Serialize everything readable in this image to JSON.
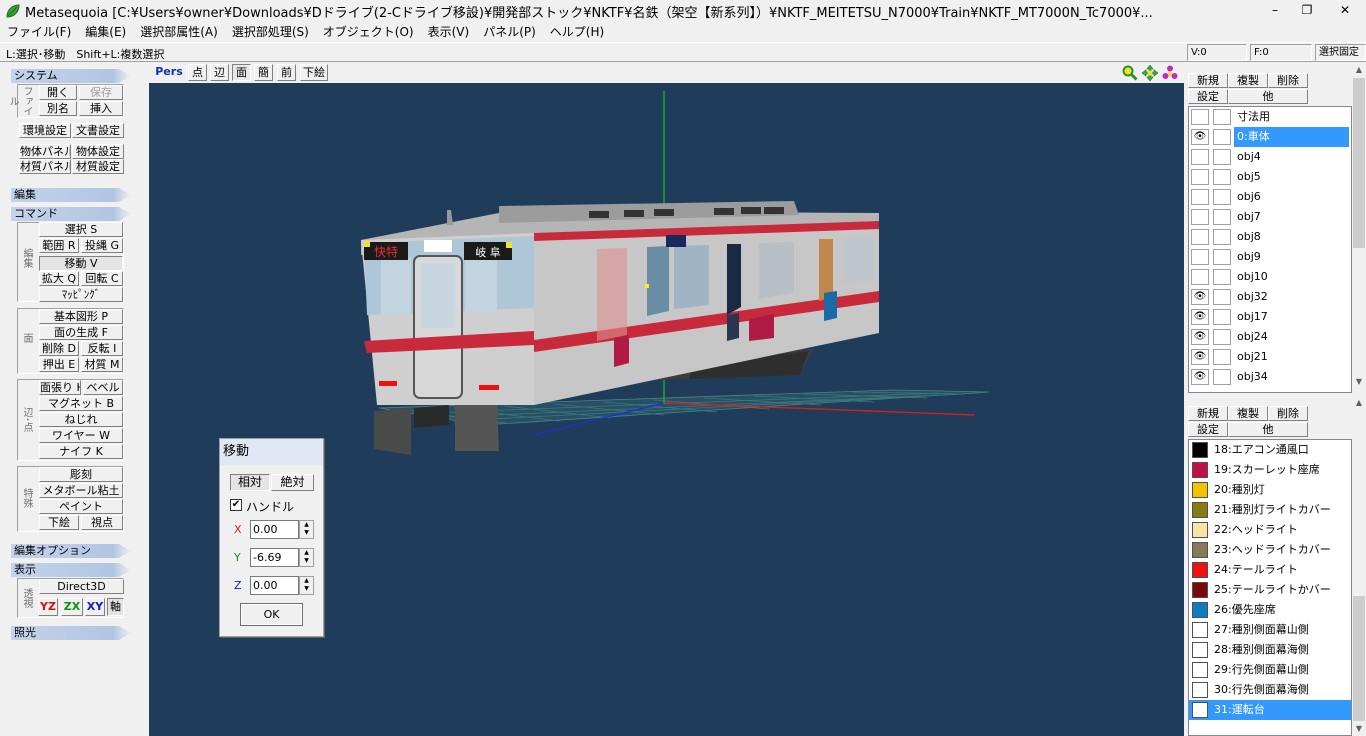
{
  "window": {
    "title": "Metasequoia [C:¥Users¥owner¥Downloads¥Dドライブ(2-Cドライブ移設)¥開発部ストック¥NKTF¥名鉄（架空【新系列】）¥NKTF_MEITETSU_N7000¥Train¥NKTF_MT7000N_Tc7000¥...",
    "minimize": "–",
    "restore": "❐",
    "close": "✕"
  },
  "menu": [
    "ファイル(F)",
    "編集(E)",
    "選択部属性(A)",
    "選択部処理(S)",
    "オブジェクト(O)",
    "表示(V)",
    "パネル(P)",
    "ヘルプ(H)"
  ],
  "status": {
    "hint": "L:選択･移動　Shift+L:複数選択",
    "v": "V:0",
    "f": "F:0",
    "lock": "選択固定"
  },
  "left": {
    "system": "システム",
    "file_label": "ファイル",
    "open": "開く",
    "save": "保存",
    "save_as": "別名",
    "insert": "挿入",
    "env": "環境設定",
    "doc": "文書設定",
    "objpanel": "物体パネル",
    "objsetting": "物体設定",
    "matpanel": "材質パネル",
    "matsetting": "材質設定",
    "edit": "編集",
    "command": "コマンド",
    "edit_label": "編集",
    "select": "選択 S",
    "range": "範囲 R",
    "lasso": "投縄 G",
    "move": "移動 V",
    "scale": "拡大 Q",
    "rotate": "回転 C",
    "mapping": "ﾏｯﾋﾟﾝｸﾞ",
    "face_label": "面",
    "basic": "基本図形 P",
    "face_gen": "面の生成 F",
    "delete": "削除 D",
    "invert": "反転 I",
    "extrude": "押出 E",
    "material": "材質 M",
    "edgevert_label": "辺･点",
    "face_paste": "面張り H",
    "bevel": "ベベル",
    "magnet": "マグネット B",
    "twist": "ねじれ",
    "wire": "ワイヤー W",
    "knife": "ナイフ K",
    "special_label": "特殊",
    "sculpt": "彫刻",
    "metaball": "メタボール粘土",
    "paint": "ペイント",
    "underlay": "下絵",
    "viewpoint": "視点",
    "edit_options": "編集オプション",
    "display": "表示",
    "persp_label": "透視",
    "direct3d": "Direct3D",
    "yz": "YZ",
    "zx": "ZX",
    "xy": "XY",
    "axis": "軸",
    "lighting": "照光"
  },
  "viewport_toolbar": {
    "pers": "Pers",
    "point": "点",
    "edge": "辺",
    "face": "面",
    "simple": "簡",
    "front": "前",
    "underlay": "下絵"
  },
  "train": {
    "type_sign": "快特",
    "dest_sign": "岐 阜"
  },
  "move_dialog": {
    "title": "移動",
    "relative": "相対",
    "absolute": "絶対",
    "handle": "ハンドル",
    "handle_checked": "✔",
    "x_label": "X",
    "y_label": "Y",
    "z_label": "Z",
    "x": "0.00",
    "y": "-6.69",
    "z": "0.00",
    "ok": "OK"
  },
  "objects_panel": {
    "new": "新規",
    "copy": "複製",
    "delete": "削除",
    "settings": "設定",
    "other": "他",
    "items": [
      {
        "name": "寸法用",
        "visible": false,
        "selected": false
      },
      {
        "name": "0:車体",
        "visible": true,
        "selected": true
      },
      {
        "name": "obj4",
        "visible": false,
        "selected": false
      },
      {
        "name": "obj5",
        "visible": false,
        "selected": false
      },
      {
        "name": "obj6",
        "visible": false,
        "selected": false
      },
      {
        "name": "obj7",
        "visible": false,
        "selected": false
      },
      {
        "name": "obj8",
        "visible": false,
        "selected": false
      },
      {
        "name": "obj9",
        "visible": false,
        "selected": false
      },
      {
        "name": "obj10",
        "visible": false,
        "selected": false
      },
      {
        "name": "obj32",
        "visible": true,
        "selected": false
      },
      {
        "name": "obj17",
        "visible": true,
        "selected": false
      },
      {
        "name": "obj24",
        "visible": true,
        "selected": false
      },
      {
        "name": "obj21",
        "visible": true,
        "selected": false
      },
      {
        "name": "obj34",
        "visible": true,
        "selected": false
      }
    ],
    "eye_glyph": "👁"
  },
  "materials_panel": {
    "new": "新規",
    "copy": "複製",
    "delete": "削除",
    "settings": "設定",
    "other": "他",
    "items": [
      {
        "name": "18:エアコン通風口",
        "color": "#000000",
        "selected": false
      },
      {
        "name": "19:スカーレット座席",
        "color": "#c0104a",
        "selected": false
      },
      {
        "name": "20:種別灯",
        "color": "#f2c300",
        "selected": false
      },
      {
        "name": "21:種別灯ライトカバー",
        "color": "#8a7c10",
        "selected": false
      },
      {
        "name": "22:ヘッドライト",
        "color": "#fbe3a8",
        "selected": false
      },
      {
        "name": "23:ヘッドライトカバー",
        "color": "#857b5b",
        "selected": false
      },
      {
        "name": "24:テールライト",
        "color": "#ee1111",
        "selected": false
      },
      {
        "name": "25:テールライトかバー",
        "color": "#7a0a0a",
        "selected": false
      },
      {
        "name": "26:優先座席",
        "color": "#0f7ac0",
        "selected": false
      },
      {
        "name": "27:種別側面幕山側",
        "color": "#ffffff",
        "selected": false
      },
      {
        "name": "28:種別側面幕海側",
        "color": "#ffffff",
        "selected": false
      },
      {
        "name": "29:行先側面幕山側",
        "color": "#ffffff",
        "selected": false
      },
      {
        "name": "30:行先側面幕海側",
        "color": "#ffffff",
        "selected": false
      },
      {
        "name": "31:運転台",
        "color": "#ffffff",
        "selected": true
      }
    ]
  }
}
